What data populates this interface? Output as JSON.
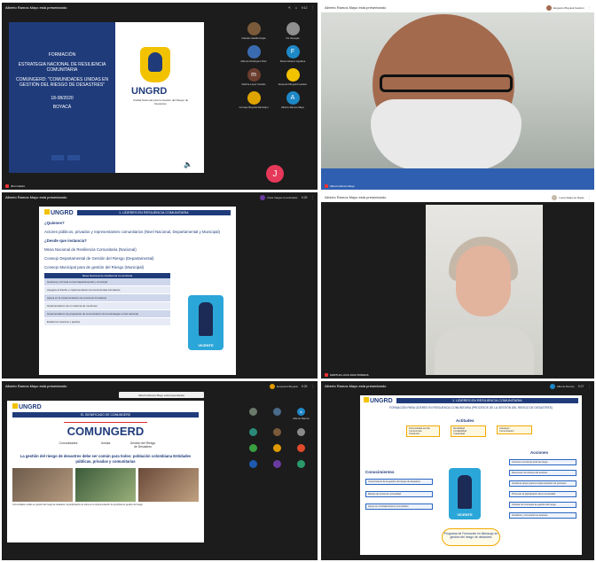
{
  "common": {
    "presenting_title": "Alberto Ramos Mayo está presentando"
  },
  "panel1": {
    "time": "9:12",
    "slide": {
      "lines": [
        "FORMACIÓN",
        "ESTRATEGIA NACIONAL DE RESILIENCIA COMUNITARIA",
        "COMUNGERD: \"COMUNIDADES UNIDAS EN GESTIÓN DEL RIESGO DE DESASTRES\"",
        "18-08/2020",
        "BOYACÁ"
      ],
      "logo_text": "UNGRD",
      "logo_sub": "Unidad Nacional para la Gestión del Riesgo de Desastres"
    },
    "participants": [
      {
        "initial": "",
        "name": "Claudia Castillo Rojas",
        "color": "#7a5a3a"
      },
      {
        "initial": "",
        "name": "Iris Vanegas",
        "color": "#8f8f8f"
      },
      {
        "initial": "",
        "name": "Alfonso Rodriguez Ruiz",
        "color": "#3a6bb0"
      },
      {
        "initial": "F",
        "name": "Flavio Alvarez Aguilera",
        "color": "#1e88c7"
      },
      {
        "initial": "m",
        "name": "Martha Lopez Giraldo",
        "color": "#6a3d2e"
      },
      {
        "initial": "",
        "name": "Ecopetrol Boyacá Gestión",
        "color": "#f2c200"
      },
      {
        "initial": "",
        "name": "Consejo Boyacá Ramiriquí",
        "color": "#e0a400"
      },
      {
        "initial": "A",
        "name": "Alberto Ramos Mayo",
        "color": "#1e88c7"
      }
    ],
    "self_initial": "J",
    "self_name": "Jhon Castro"
  },
  "panel2": {
    "participant_name": "Ecopetrol Boyacá Gestión",
    "name_label": "Alberto Ramos Mayo"
  },
  "panel3": {
    "chip": "Flora Vargas Coordinador",
    "time": "9:25",
    "slide": {
      "logo": "UNGRD",
      "header": "1. LÍDERES EN RESILIENCIA COMUNITARIA",
      "q1": "¿Quienes?",
      "a1": "Actores públicos, privados y representantes comunitarios (Nivel Nacional, Departamental y Municipal)",
      "q2": "¿Desde que instancia?",
      "levels": [
        "Mesa Nacional de Resiliencia Comunitaria (Nacional)",
        "Consejo Departamental de Gestión del Riesgo (Departamental)",
        "Consejo Municipal para de gestión del Riesgo (Municipal)"
      ],
      "table_header": "Mesa Nacional de Resiliencia Comunitaria",
      "table_rows": [
        "Gestiona y formula a nivel departamental y municipal",
        "Asegura el diseño e implementación de herramientas formativas",
        "Apoya en la implementación de procesos formativos",
        "Implementación de un sistema de monitoreo",
        "Implementación de programas de comunicación de la estrategia a nivel nacional",
        "Evalúa los avances y ajustes"
      ],
      "mascot": "VICENTE"
    }
  },
  "panel4": {
    "chip": "Lucia Salas de Rojas",
    "name_label": "MARTHA LUCIA DIAZ MORENA"
  },
  "panel5": {
    "chip": "Ecopetrol Boyacá",
    "time": "9:26",
    "banner": "Alberto Ramos Mayo está presentando",
    "slide": {
      "logo": "UNGRD",
      "header": "EL SIGNIFICADO DE COMUNGERD",
      "word": "COMUNGERD",
      "labels": [
        "Comunidades",
        "Unidas",
        "Gestión del Riesgo de Desastres"
      ],
      "text": "La gestión del riesgo de desastres debe ser común para todos: población colombiana Entidades públicas, privadas y comunitarias",
      "foot": "Comunidades unidas en gestión del riesgo de desastres: la participación de todos en la implementación de la política de gestión del riesgo"
    },
    "participants": [
      {
        "initial": "",
        "name": "",
        "color": "#6a7a6a"
      },
      {
        "initial": "",
        "name": "",
        "color": "#4a6a8a"
      },
      {
        "initial": "A",
        "name": "Alberto Ramos",
        "color": "#1e88c7"
      },
      {
        "initial": "",
        "name": "",
        "color": "#2a8a7a"
      },
      {
        "initial": "",
        "name": "",
        "color": "#7a5a3a"
      },
      {
        "initial": "",
        "name": "",
        "color": "#8a8a8a"
      },
      {
        "initial": "",
        "name": "",
        "color": "#3aa040"
      },
      {
        "initial": "",
        "name": "",
        "color": "#e09a00"
      },
      {
        "initial": "",
        "name": "",
        "color": "#e04a2a"
      },
      {
        "initial": "",
        "name": "",
        "color": "#1e5ab0"
      },
      {
        "initial": "",
        "name": "",
        "color": "#6a3aa0"
      },
      {
        "initial": "",
        "name": "",
        "color": "#2a9a6a"
      }
    ]
  },
  "panel6": {
    "chip": "Alberto Ramos",
    "time": "9:27",
    "slide": {
      "logo": "UNGRD",
      "header": "1. LÍDERES EN RESILIENCIA COMUNITARIA",
      "sub": "FORMACIÓN PARA LÍDERES EN RESILIENCIA COMUNITARIA (PROCESOS DE LA GESTIÓN DEL RIESGO DE DESASTRES)",
      "attitudes_title": "Actitudes",
      "attitudes": [
        "Personalidad acorde",
        "Compromiso",
        "Tolerancia",
        "Flexibilidad",
        "Confiabilidad",
        "Creatividad",
        "Liderazgo",
        "Comunicación"
      ],
      "knowledge_title": "Conocimientos",
      "knowledge": [
        "Conocimiento de la gestión del riesgo de desastres",
        "Manejo de temas de comunidad",
        "Apoyo en el fortalecimiento comunitario"
      ],
      "actions_title": "Acciones",
      "actions": [
        "Conocer el contexto local de riesgo",
        "Reconocer los actores del territorio",
        "Gestionar apoyo para la implementación de procesos",
        "Promover la participación de la comunidad",
        "Articular los Consejos de gestión del riesgo",
        "Socializar y comunicar los avances"
      ],
      "mascot": "VICENTE",
      "goal": "Programa de Formación en liderazgo en gestión del riesgo de desastres"
    }
  }
}
